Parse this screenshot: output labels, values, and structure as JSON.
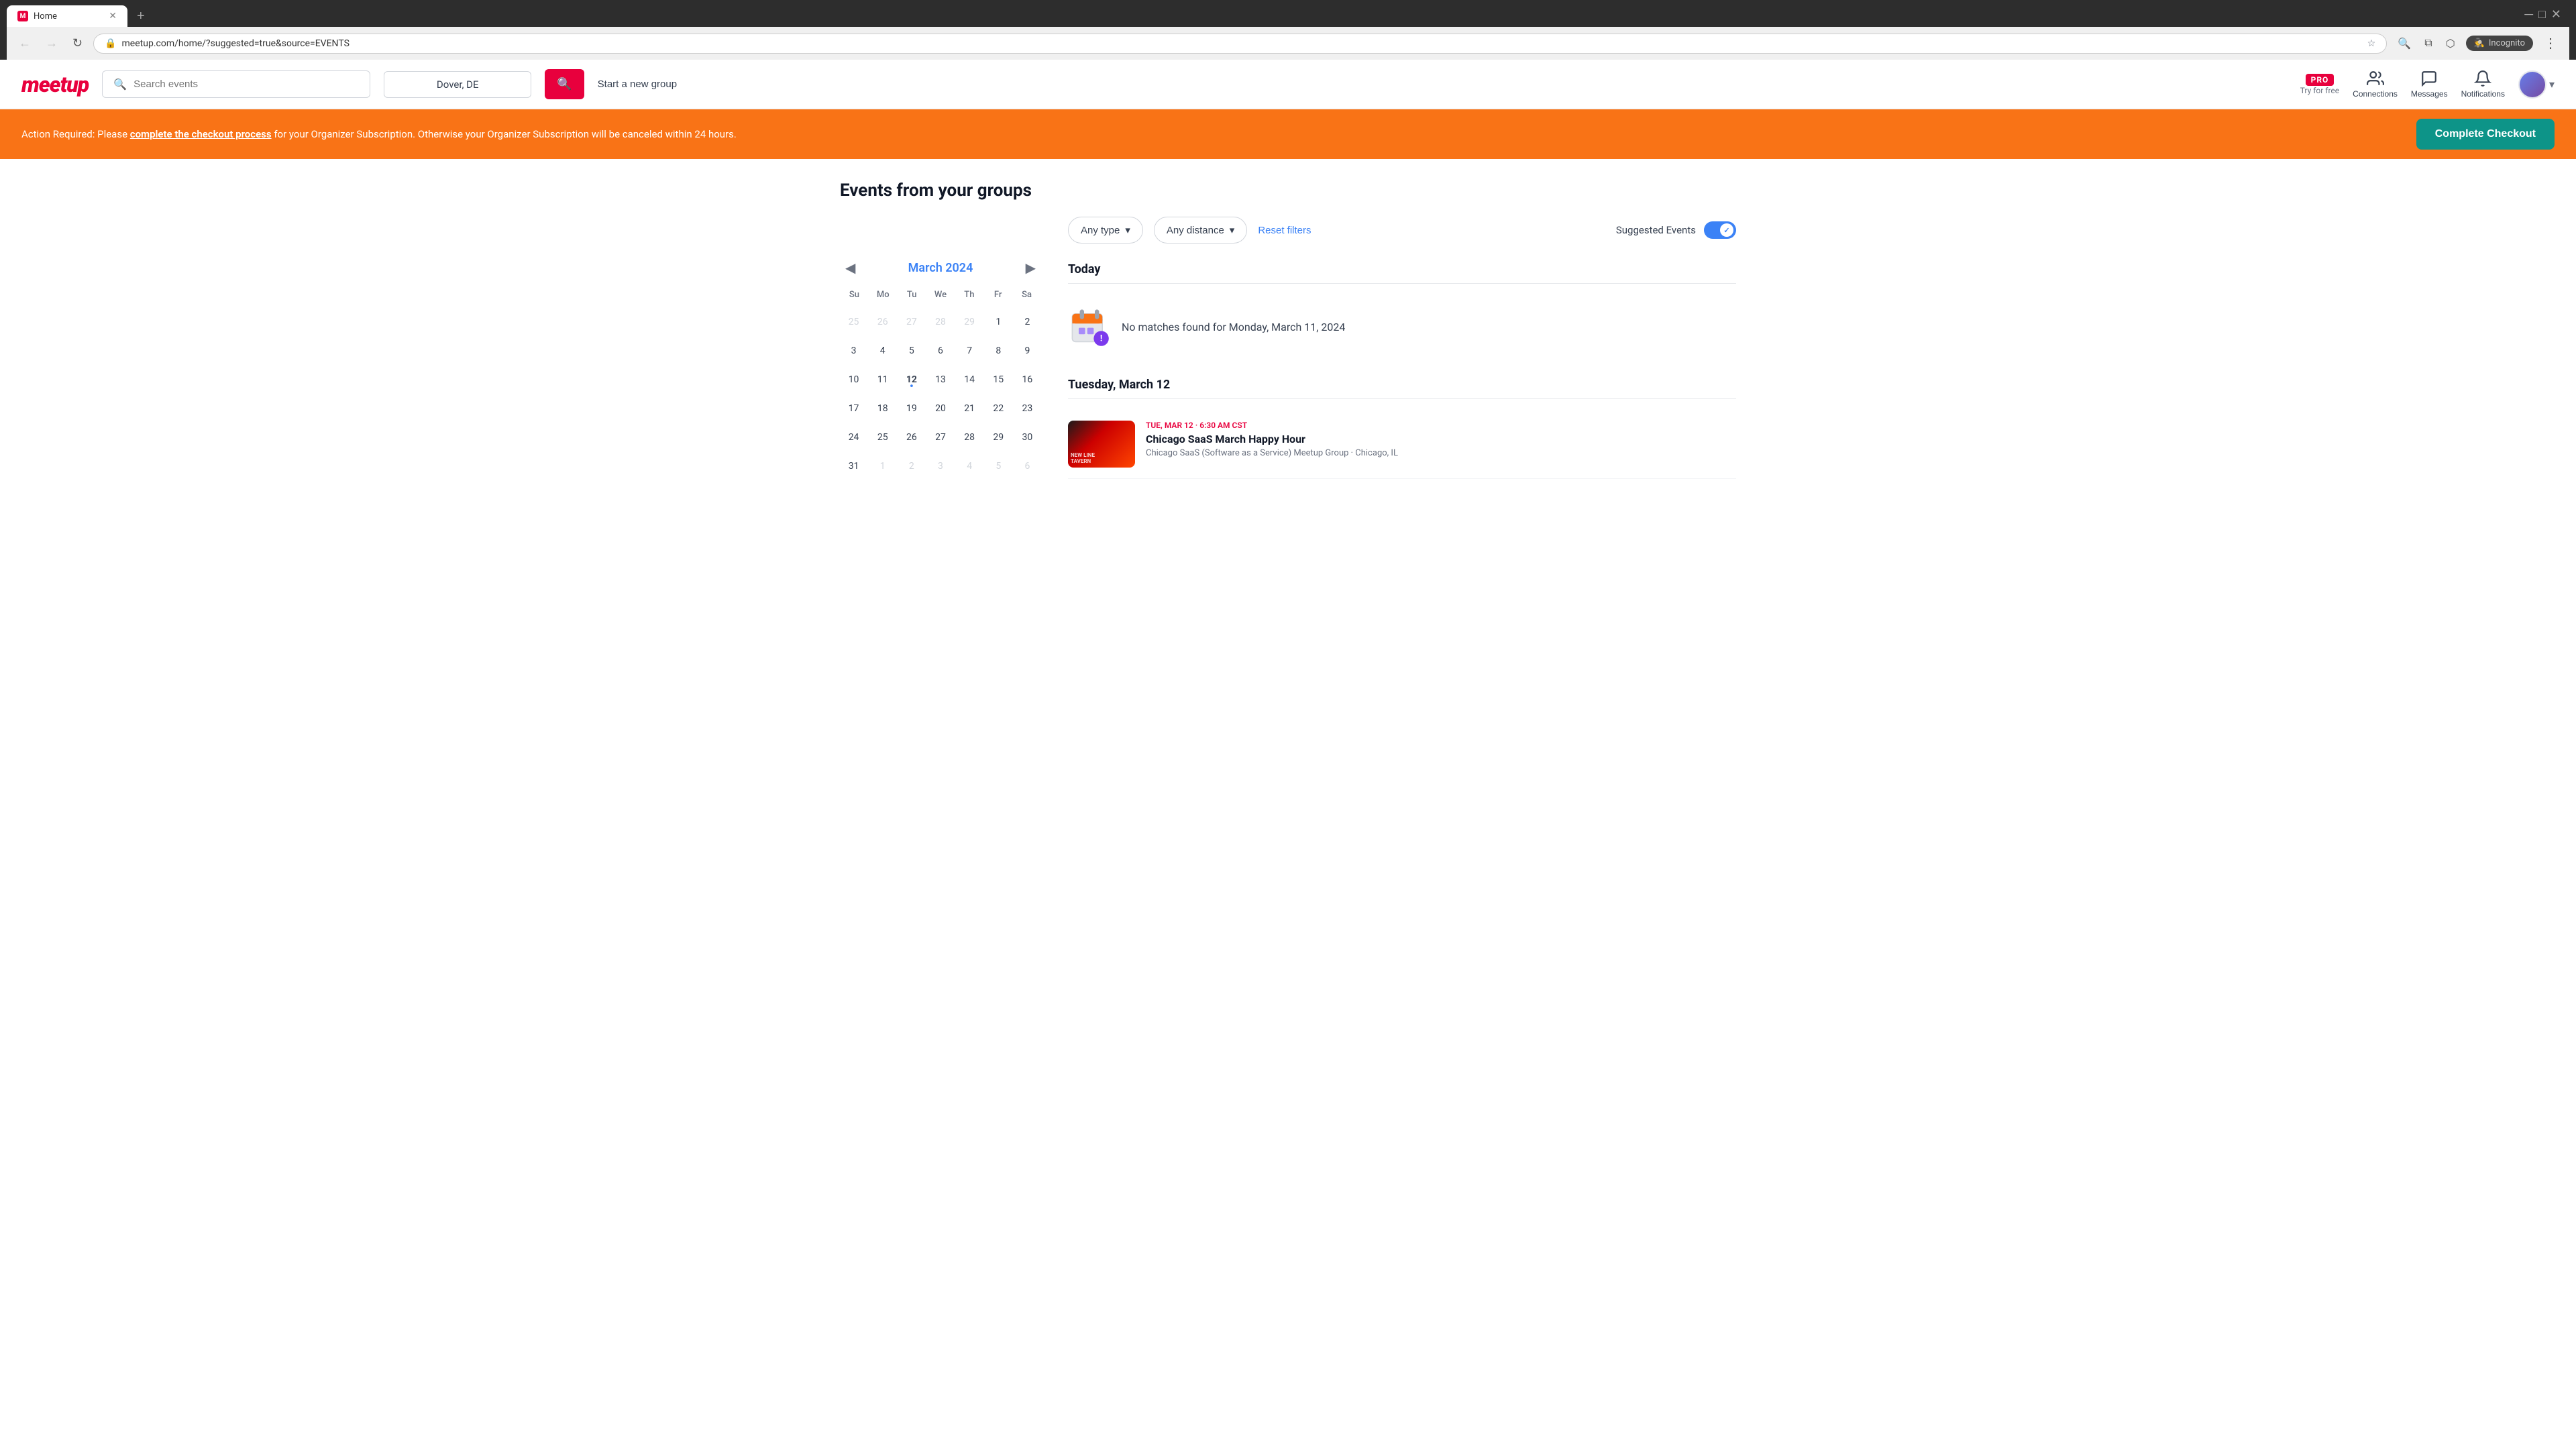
{
  "browser": {
    "tab_title": "Home",
    "tab_favicon": "M",
    "url": "meetup.com/home/?suggested=true&source=EVENTS",
    "new_tab_label": "+",
    "nav": {
      "back_label": "←",
      "forward_label": "→",
      "reload_label": "↻",
      "home_label": "⌂"
    },
    "incognito_label": "Incognito",
    "toolbar_icons": {
      "search": "🔍",
      "star": "☆",
      "extensions": "⧉",
      "profile": "⬡",
      "menu": "⋮"
    }
  },
  "navbar": {
    "logo_text": "meetup",
    "search_placeholder": "Search events",
    "location": "Dover, DE",
    "search_button_icon": "🔍",
    "start_group_label": "Start a new group",
    "pro": {
      "badge_label": "PRO",
      "subtitle": "Try for free"
    },
    "connections_label": "Connections",
    "messages_label": "Messages",
    "notifications_label": "Notifications",
    "dropdown_icon": "▾"
  },
  "alert": {
    "text_before_link": "Action Required: Please ",
    "link_text": "complete the checkout process",
    "text_after_link": " for your Organizer Subscription. Otherwise your Organizer Subscription will be canceled within 24 hours.",
    "button_label": "Complete Checkout"
  },
  "main": {
    "section_title": "Events from your groups",
    "filters": {
      "type_label": "Any type",
      "type_icon": "▾",
      "distance_label": "Any distance",
      "distance_icon": "▾",
      "reset_label": "Reset filters",
      "suggested_label": "Suggested Events"
    },
    "calendar": {
      "month": "March 2024",
      "prev_icon": "◀",
      "next_icon": "▶",
      "weekdays": [
        "Su",
        "Mo",
        "Tu",
        "We",
        "Th",
        "Fr",
        "Sa"
      ],
      "weeks": [
        [
          {
            "day": "25",
            "other": true
          },
          {
            "day": "26",
            "other": true
          },
          {
            "day": "27",
            "other": true
          },
          {
            "day": "28",
            "other": true
          },
          {
            "day": "29",
            "other": true
          },
          {
            "day": "1",
            "other": false
          },
          {
            "day": "2",
            "other": false
          }
        ],
        [
          {
            "day": "3",
            "other": false
          },
          {
            "day": "4",
            "other": false
          },
          {
            "day": "5",
            "other": false
          },
          {
            "day": "6",
            "other": false
          },
          {
            "day": "7",
            "other": false
          },
          {
            "day": "8",
            "other": false
          },
          {
            "day": "9",
            "other": false
          }
        ],
        [
          {
            "day": "10",
            "other": false
          },
          {
            "day": "11",
            "other": false
          },
          {
            "day": "12",
            "other": false,
            "today": true
          },
          {
            "day": "13",
            "other": false
          },
          {
            "day": "14",
            "other": false
          },
          {
            "day": "15",
            "other": false
          },
          {
            "day": "16",
            "other": false
          }
        ],
        [
          {
            "day": "17",
            "other": false
          },
          {
            "day": "18",
            "other": false
          },
          {
            "day": "19",
            "other": false
          },
          {
            "day": "20",
            "other": false
          },
          {
            "day": "21",
            "other": false
          },
          {
            "day": "22",
            "other": false
          },
          {
            "day": "23",
            "other": false
          }
        ],
        [
          {
            "day": "24",
            "other": false
          },
          {
            "day": "25",
            "other": false
          },
          {
            "day": "26",
            "other": false
          },
          {
            "day": "27",
            "other": false
          },
          {
            "day": "28",
            "other": false
          },
          {
            "day": "29",
            "other": false
          },
          {
            "day": "30",
            "other": false
          }
        ],
        [
          {
            "day": "31",
            "other": false
          },
          {
            "day": "1",
            "other": true
          },
          {
            "day": "2",
            "other": true
          },
          {
            "day": "3",
            "other": true
          },
          {
            "day": "4",
            "other": true
          },
          {
            "day": "5",
            "other": true
          },
          {
            "day": "6",
            "other": true
          }
        ]
      ]
    },
    "today_section": {
      "header": "Today",
      "no_matches_text": "No matches found for Monday, March 11, 2024"
    },
    "tuesday_section": {
      "header": "Tuesday, March 12",
      "events": [
        {
          "date_time": "TUE, MAR 12 · 6:30 AM CST",
          "title": "Chicago SaaS March Happy Hour",
          "group": "Chicago SaaS (Software as a Service) Meetup Group · Chicago, IL",
          "img_label": "NEW LINE TAVERN"
        }
      ]
    }
  },
  "colors": {
    "brand_red": "#e8003d",
    "orange": "#f97316",
    "teal": "#0d9488",
    "blue": "#3b82f6"
  }
}
